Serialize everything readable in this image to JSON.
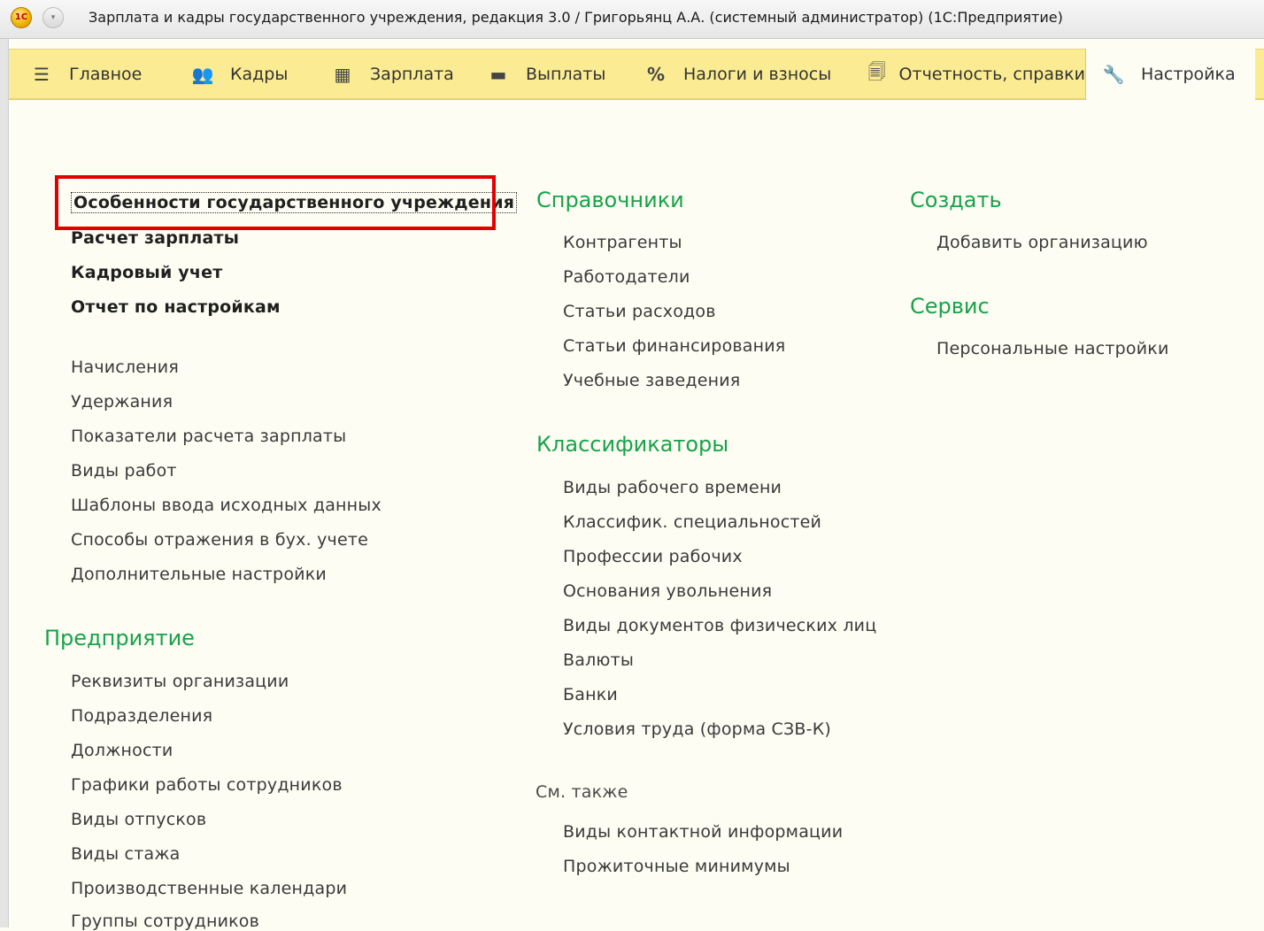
{
  "window": {
    "title": "Зарплата и кадры государственного учреждения, редакция 3.0 / Григорьянц А.А. (системный администратор)  (1С:Предприятие)",
    "logo_text": "1С"
  },
  "sections": [
    {
      "label": "Главное",
      "icon": "menu-lines-icon",
      "glyph": "☰"
    },
    {
      "label": "Кадры",
      "icon": "people-icon",
      "glyph": "👥"
    },
    {
      "label": "Зарплата",
      "icon": "calculator-icon",
      "glyph": "▦"
    },
    {
      "label": "Выплаты",
      "icon": "wallet-icon",
      "glyph": "▬"
    },
    {
      "label": "Налоги и взносы",
      "icon": "percent-icon",
      "glyph": "%"
    },
    {
      "label": "Отчетность, справки",
      "icon": "reports-icon",
      "glyph": "🗐"
    },
    {
      "label": "Настройка",
      "icon": "wrench-icon",
      "glyph": "🔧",
      "active": true
    }
  ],
  "col1": {
    "bold_items": [
      "Особенности государственного учреждения",
      "Расчет зарплаты",
      "Кадровый учет",
      "Отчет по настройкам"
    ],
    "items": [
      "Начисления",
      "Удержания",
      "Показатели расчета зарплаты",
      "Виды работ",
      "Шаблоны ввода исходных данных",
      "Способы отражения в бух. учете",
      "Дополнительные настройки"
    ],
    "enterprise_title": "Предприятие",
    "enterprise_items": [
      "Реквизиты организации",
      "Подразделения",
      "Должности",
      "Графики работы сотрудников",
      "Виды отпусков",
      "Виды стажа",
      "Производственные календари",
      "Группы сотрудников"
    ]
  },
  "col2": {
    "ref_title": "Справочники",
    "ref_items": [
      "Контрагенты",
      "Работодатели",
      "Статьи расходов",
      "Статьи финансирования",
      "Учебные заведения"
    ],
    "class_title": "Классификаторы",
    "class_items": [
      "Виды рабочего времени",
      "Классифик. специальностей",
      "Профессии рабочих",
      "Основания увольнения",
      "Виды документов физических лиц",
      "Валюты",
      "Банки",
      "Условия труда (форма СЗВ-К)"
    ],
    "see_also_title": "См. также",
    "see_also_items": [
      "Виды контактной информации",
      "Прожиточные минимумы"
    ]
  },
  "col3": {
    "create_title": "Создать",
    "create_items": [
      "Добавить организацию"
    ],
    "service_title": "Сервис",
    "service_items": [
      "Персональные настройки"
    ]
  },
  "colors": {
    "accent_green": "#18a34a",
    "sections_bg": "#fbec93",
    "highlight": "#e00000"
  }
}
